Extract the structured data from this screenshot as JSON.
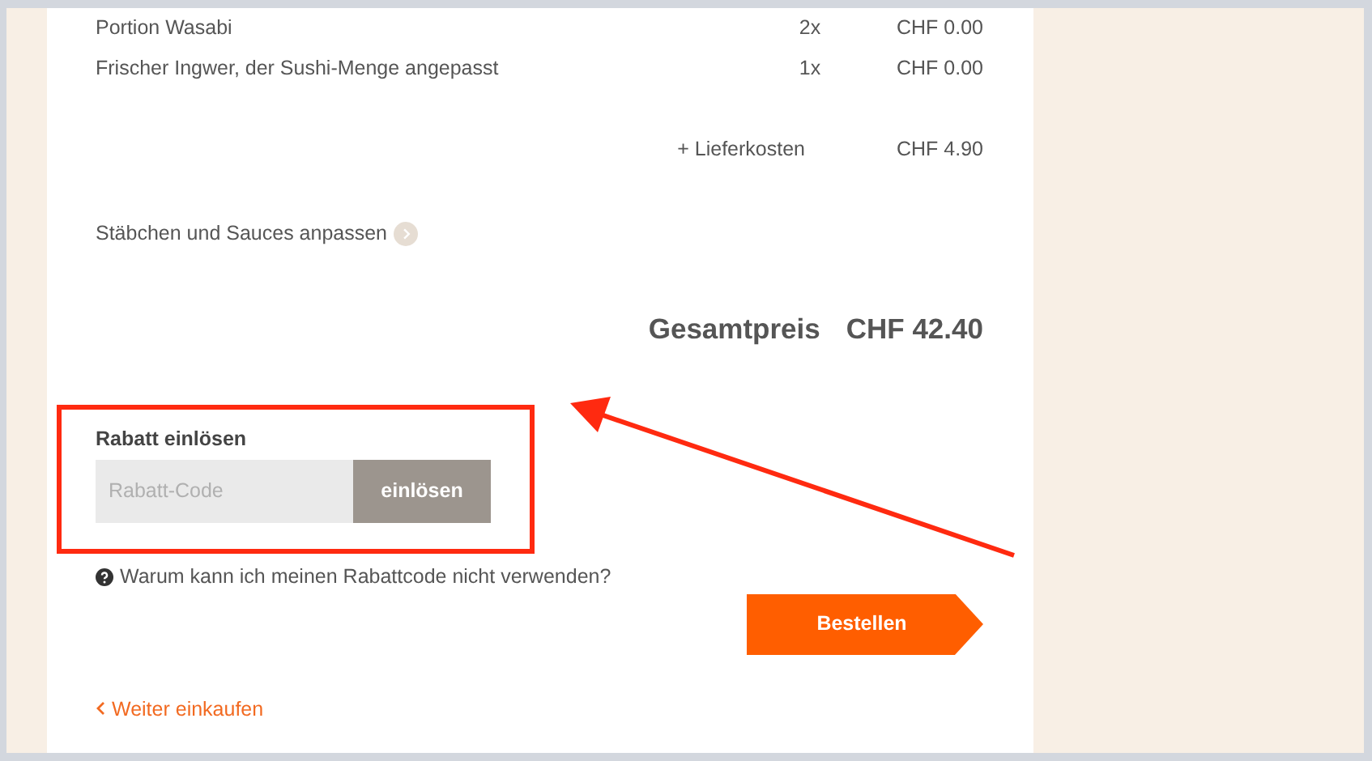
{
  "order_items": [
    {
      "name": "Portion Wasabi",
      "quantity": "2x",
      "price": "CHF 0.00"
    },
    {
      "name": "Frischer Ingwer, der Sushi-Menge angepasst",
      "quantity": "1x",
      "price": "CHF 0.00"
    }
  ],
  "delivery": {
    "label": "+ Lieferkosten",
    "price": "CHF 4.90"
  },
  "customize_link": "Stäbchen und Sauces anpassen",
  "total": {
    "label": "Gesamtpreis",
    "amount": "CHF 42.40"
  },
  "discount": {
    "title": "Rabatt einlösen",
    "placeholder": "Rabatt-Code",
    "button": "einlösen"
  },
  "help_link": "Warum kann ich meinen Rabattcode nicht verwenden?",
  "order_button": "Bestellen",
  "back_link": "Weiter einkaufen"
}
